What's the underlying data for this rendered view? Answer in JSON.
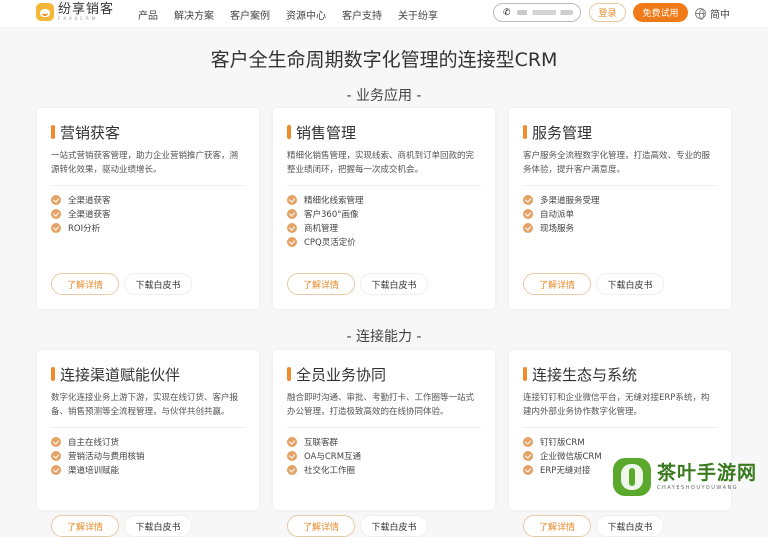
{
  "header": {
    "logo_name": "纷享销客",
    "logo_sub": "FXXKCRM",
    "nav": [
      "产品",
      "解决方案",
      "客户案例",
      "资源中心",
      "客户支持",
      "关于纷享"
    ],
    "phone_icon": "phone-icon",
    "login_label": "登录",
    "trial_label": "免费试用",
    "lang_label": "简中",
    "accent_color": "#f07a17"
  },
  "main_title": "客户全生命周期数字化管理的连接型CRM",
  "sections": [
    {
      "title": "- 业务应用 -",
      "cards": [
        {
          "title": "营销获客",
          "desc": "一站式营销获客管理，助力企业营销推广获客，溯源转化效果，驱动业绩增长。",
          "features": [
            "全渠道获客",
            "全渠道获客",
            "ROI分析"
          ],
          "detail_label": "了解详情",
          "download_label": "下载白皮书"
        },
        {
          "title": "销售管理",
          "desc": "精细化销售管理，实现线索、商机到订单回款的完整业绩闭环，把握每一次成交机会。",
          "features": [
            "精细化线索管理",
            "客户360°画像",
            "商机管理",
            "CPQ灵活定价"
          ],
          "detail_label": "了解详情",
          "download_label": "下载白皮书"
        },
        {
          "title": "服务管理",
          "desc": "客户服务全流程数字化管理，打造高效、专业的服务体验，提升客户满意度。",
          "features": [
            "多渠道服务受理",
            "自动派单",
            "现场服务"
          ],
          "detail_label": "了解详情",
          "download_label": "下载白皮书"
        }
      ]
    },
    {
      "title": "- 连接能力 -",
      "cards": [
        {
          "title": "连接渠道赋能伙伴",
          "desc": "数字化连接业务上游下游，实现在线订货、客户报备、销售预测等全流程管理，与伙伴共创共赢。",
          "features": [
            "自主在线订货",
            "营销活动与费用核销",
            "渠道培训赋能"
          ],
          "detail_label": "了解详情",
          "download_label": "下载白皮书"
        },
        {
          "title": "全员业务协同",
          "desc": "融合即时沟通、审批、考勤打卡、工作圈等一站式办公管理，打造极致高效的在线协同体验。",
          "features": [
            "互联客群",
            "OA与CRM互通",
            "社交化工作圈"
          ],
          "detail_label": "了解详情",
          "download_label": "下载白皮书"
        },
        {
          "title": "连接生态与系统",
          "desc": "连接钉钉和企业微信平台，无缝对接ERP系统，构建内外部业务协作数字化管理。",
          "features": [
            "钉钉版CRM",
            "企业微信版CRM",
            "ERP无缝对接"
          ],
          "detail_label": "了解详情",
          "download_label": "下载白皮书"
        }
      ]
    }
  ],
  "watermark": {
    "name": "茶叶手游网",
    "sub": "CHAYESHOUYOUWANG"
  }
}
